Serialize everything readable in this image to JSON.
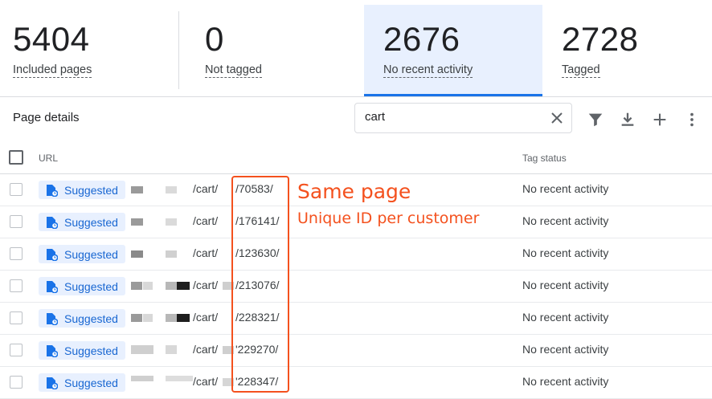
{
  "stats": [
    {
      "value": "5404",
      "label": "Included pages"
    },
    {
      "value": "0",
      "label": "Not tagged"
    },
    {
      "value": "2676",
      "label": "No recent activity"
    },
    {
      "value": "2728",
      "label": "Tagged"
    }
  ],
  "section_title": "Page details",
  "search": {
    "value": "cart"
  },
  "table": {
    "columns": [
      "URL",
      "Tag status"
    ],
    "rows": [
      {
        "chip": "Suggested",
        "path": "/cart/",
        "id": "/70583/",
        "status": "No recent activity"
      },
      {
        "chip": "Suggested",
        "path": "/cart/",
        "id": "/176141/",
        "status": "No recent activity"
      },
      {
        "chip": "Suggested",
        "path": "/cart/",
        "id": "/123630/",
        "status": "No recent activity"
      },
      {
        "chip": "Suggested",
        "path": "/cart/",
        "id": "/213076/",
        "status": "No recent activity"
      },
      {
        "chip": "Suggested",
        "path": "/cart/",
        "id": "/228321/",
        "status": "No recent activity"
      },
      {
        "chip": "Suggested",
        "path": "/cart/",
        "id": "'229270/",
        "status": "No recent activity"
      },
      {
        "chip": "Suggested",
        "path": "/cart/",
        "id": "'228347/",
        "status": "No recent activity"
      }
    ]
  },
  "annotation": {
    "line1": "Same page",
    "line2": "Unique ID per customer"
  },
  "colors": {
    "accent": "#1a73e8",
    "annotation": "#f4511e",
    "chip_bg": "#e8f0fe"
  }
}
